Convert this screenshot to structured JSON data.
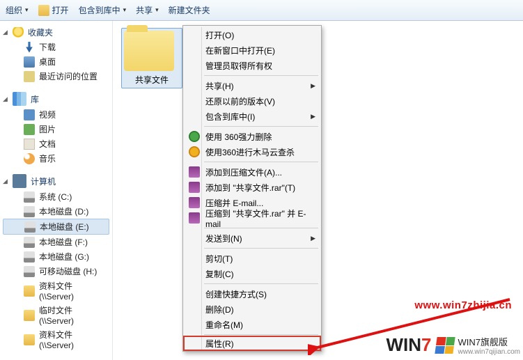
{
  "toolbar": {
    "organize": "组织",
    "open": "打开",
    "include_in_library": "包含到库中",
    "share": "共享",
    "new_folder": "新建文件夹"
  },
  "sidebar": {
    "favorites": {
      "label": "收藏夹"
    },
    "downloads": {
      "label": "下载"
    },
    "desktop": {
      "label": "桌面"
    },
    "recent": {
      "label": "最近访问的位置"
    },
    "libraries": {
      "label": "库"
    },
    "videos": {
      "label": "视频"
    },
    "pictures": {
      "label": "图片"
    },
    "documents": {
      "label": "文档"
    },
    "music": {
      "label": "音乐"
    },
    "computer": {
      "label": "计算机"
    },
    "drive_c": {
      "label": "系统 (C:)"
    },
    "drive_d": {
      "label": "本地磁盘 (D:)"
    },
    "drive_e": {
      "label": "本地磁盘 (E:)"
    },
    "drive_f": {
      "label": "本地磁盘 (F:)"
    },
    "drive_g": {
      "label": "本地磁盘 (G:)"
    },
    "removable_h": {
      "label": "可移动磁盘 (H:)"
    },
    "net_res": {
      "label": "资料文件 (\\\\Server)"
    },
    "net_temp": {
      "label": "临时文件 (\\\\Server)"
    },
    "net_res2": {
      "label": "资料文件 (\\\\Server)"
    }
  },
  "content": {
    "folder_name": "共享文件"
  },
  "context_menu": {
    "open": "打开(O)",
    "open_new_window": "在新窗口中打开(E)",
    "admin_ownership": "管理员取得所有权",
    "share": "共享(H)",
    "restore_versions": "还原以前的版本(V)",
    "include_in_library": "包含到库中(I)",
    "use_360_delete": "使用 360强力删除",
    "use_360_scan": "使用360进行木马云查杀",
    "add_to_archive": "添加到压缩文件(A)...",
    "add_to_rar": "添加到 \"共享文件.rar\"(T)",
    "compress_email": "压缩并 E-mail...",
    "compress_rar_email": "压缩到 \"共享文件.rar\" 并 E-mail",
    "send_to": "发送到(N)",
    "cut": "剪切(T)",
    "copy": "复制(C)",
    "create_shortcut": "创建快捷方式(S)",
    "delete": "删除(D)",
    "rename": "重命名(M)",
    "properties": "属性(R)"
  },
  "watermark": {
    "url": "www.win7zhijia.cn",
    "brand_prefix": "WIN",
    "brand_digit": "7",
    "brand_text": "WIN7旗舰版",
    "brand_sub": "www.win7qijian.com"
  }
}
